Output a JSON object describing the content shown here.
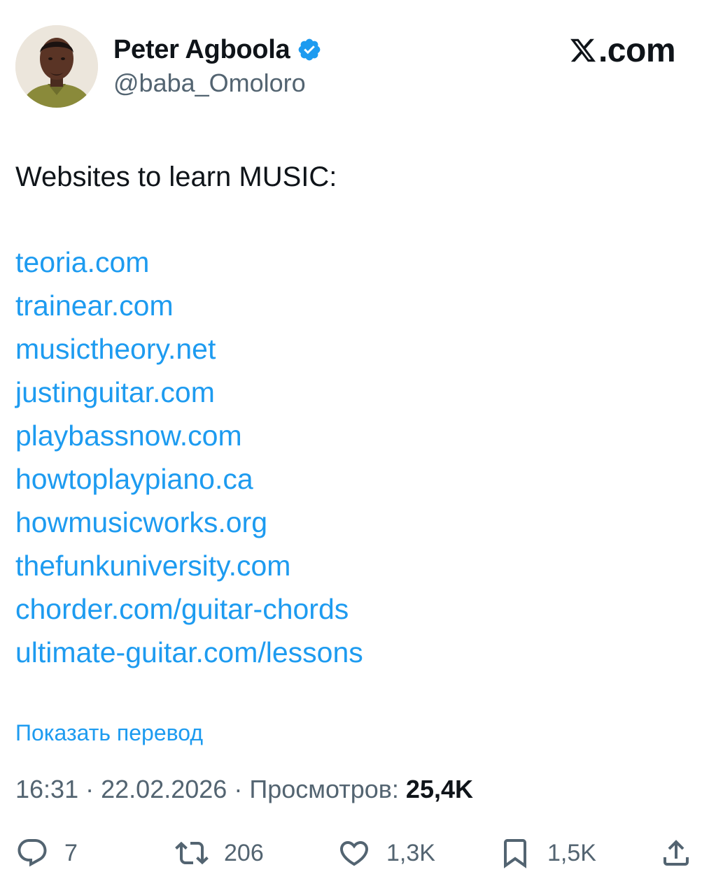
{
  "author": {
    "name": "Peter Agboola",
    "handle": "@baba_Omoloro",
    "verified": true,
    "avatar_icon": "profile-photo"
  },
  "site": {
    "logo_text": ".com",
    "logo_icon": "x-logo-icon"
  },
  "tweet": {
    "text": "Websites to learn MUSIC:",
    "links": [
      "teoria.com",
      "trainear.com",
      "musictheory.net",
      "justinguitar.com",
      "playbassnow.com",
      "howtoplaypiano.ca",
      "howmusicworks.org",
      "thefunkuniversity.com",
      "chorder.com/guitar-chords",
      "ultimate-guitar.com/lessons"
    ],
    "translate_label": "Показать перевод"
  },
  "meta": {
    "time": "16:31",
    "separator": "·",
    "date": "22.02.2026",
    "views_label": "Просмотров:",
    "views_count": "25,4K"
  },
  "actions": {
    "replies": "7",
    "reposts": "206",
    "likes": "1,3K",
    "bookmarks": "1,5K"
  },
  "colors": {
    "link": "#1d9bf0",
    "secondary_text": "#536471",
    "primary_text": "#0f1419",
    "verified_badge": "#1d9bf0"
  }
}
